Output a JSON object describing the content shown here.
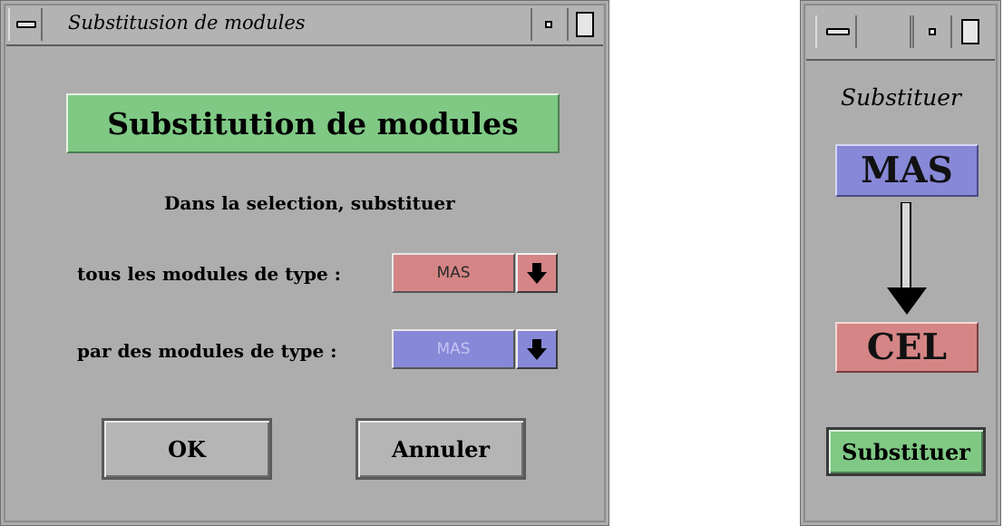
{
  "left_window": {
    "title": "Substitusion de modules",
    "heading": "Substitution de modules",
    "instruction": "Dans la selection, substituer",
    "row1_label": "tous les modules de type :",
    "row1_value": "MAS",
    "row2_label": "par des modules de type :",
    "row2_value": "MAS",
    "ok_label": "OK",
    "cancel_label": "Annuler"
  },
  "right_window": {
    "caption": "Substituer",
    "from_type": "MAS",
    "to_type": "CEL",
    "action_label": "Substituer"
  },
  "colors": {
    "window_bg": "#adadad",
    "green": "#7fc985",
    "red": "#d58585",
    "blue": "#8888d8"
  },
  "icons": {
    "window_menu": "window-menu-icon",
    "minimize": "minimize-icon",
    "maximize": "maximize-icon",
    "dropdown": "down-arrow-icon",
    "flow": "down-arrow-icon"
  }
}
